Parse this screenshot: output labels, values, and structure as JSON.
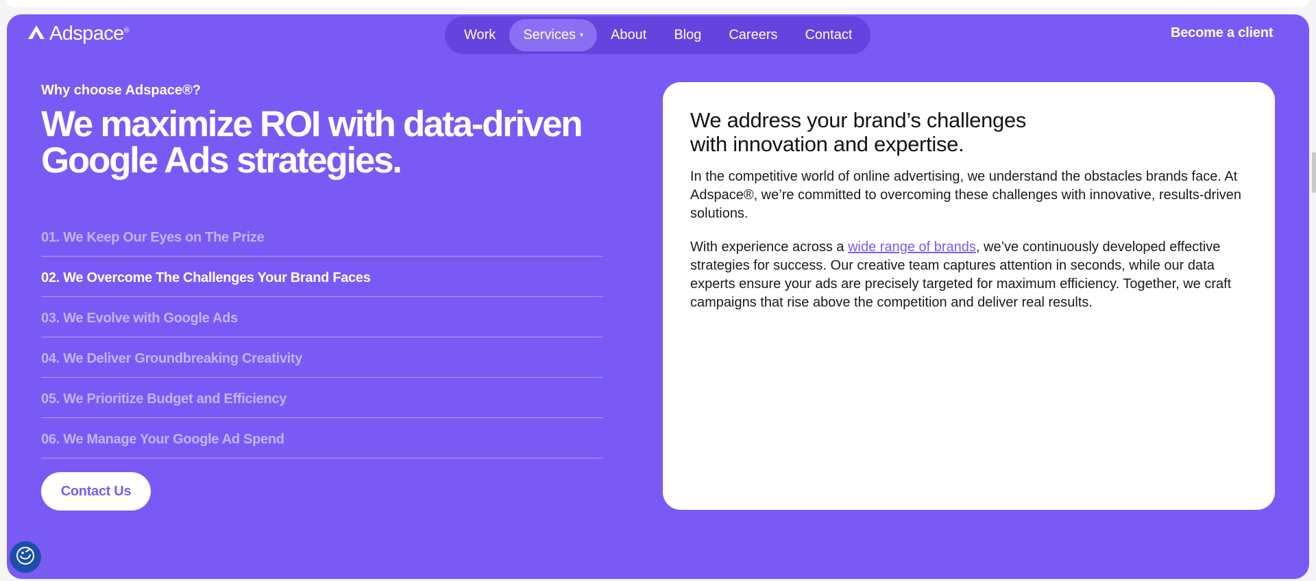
{
  "header": {
    "brand": "Adspace",
    "brand_mark": "®",
    "nav": [
      {
        "label": "Work"
      },
      {
        "label": "Services",
        "caret": "▾"
      },
      {
        "label": "About"
      },
      {
        "label": "Blog"
      },
      {
        "label": "Careers"
      },
      {
        "label": "Contact"
      }
    ],
    "cta": "Become a client"
  },
  "hero": {
    "eyebrow": "Why choose Adspace®?",
    "headline": "We maximize ROI with data-driven Google Ads strategies.",
    "reasons": [
      "01. We Keep Our Eyes on The Prize",
      "02. We Overcome The Challenges Your Brand Faces",
      "03. We Evolve with Google Ads",
      "04. We Deliver Groundbreaking Creativity",
      "05. We Prioritize Budget and Efficiency",
      "06. We Manage Your Google Ad Spend"
    ],
    "active_reason": "02. We Overcome The Challenges Your Brand Faces",
    "contact_button": "Contact Us"
  },
  "card": {
    "title_line1": "We address your brand’s challenges",
    "title_line2": "with innovation and expertise.",
    "paragraph1": "In the competitive world of online advertising, we understand the obstacles brands face. At Adspace®, we’re committed to overcoming these challenges with innovative, results-driven solutions.",
    "paragraph2_before": "With experience across a ",
    "paragraph2_link": "wide range of brands",
    "paragraph2_after": ", we’ve continuously developed effective strategies for success. Our creative team captures attention in seconds, while our data experts ensure your ads are precisely targeted for maximum efficiency. Together, we craft campaigns that rise above the competition and deliver real results."
  },
  "colors": {
    "brand_purple": "#7a5af5",
    "nav_pill": "#6443df",
    "nav_active": "#8a6ff2",
    "card_bg": "#ffffff",
    "a11y_blue": "#1b4fa8"
  },
  "icons": {
    "logo": "adspace-logo-icon",
    "accessibility": "accessibility-icon"
  }
}
